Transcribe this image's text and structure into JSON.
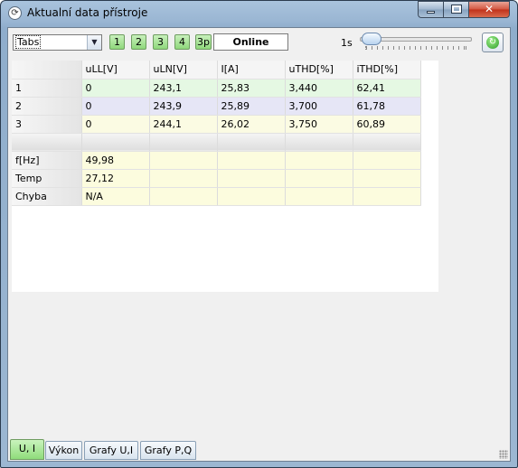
{
  "window": {
    "title": "Aktualní data přístroje",
    "app_icon": "refresh-cycle-icon"
  },
  "toolbar": {
    "mode_select": {
      "value": "Tabs"
    },
    "phase_buttons": [
      "1",
      "2",
      "3",
      "4",
      "3p"
    ],
    "status": "Online",
    "interval_label": "1s",
    "refresh_icon": "refresh-icon"
  },
  "table": {
    "columns": [
      "uLL[V]",
      "uLN[V]",
      "I[A]",
      "uTHD[%]",
      "iTHD[%]"
    ],
    "phase_rows": [
      {
        "label": "1",
        "values": [
          "0",
          "243,1",
          "25,83",
          "3,440",
          "62,41"
        ]
      },
      {
        "label": "2",
        "values": [
          "0",
          "243,9",
          "25,89",
          "3,700",
          "61,78"
        ]
      },
      {
        "label": "3",
        "values": [
          "0",
          "244,1",
          "26,02",
          "3,750",
          "60,89"
        ]
      }
    ],
    "extra_rows": [
      {
        "label": "f[Hz]",
        "value": "49,98"
      },
      {
        "label": "Temp",
        "value": "27,12"
      },
      {
        "label": "Chyba",
        "value": "N/A"
      }
    ]
  },
  "tabs": [
    {
      "label": "U, I",
      "active": true
    },
    {
      "label": "Výkon",
      "active": false
    },
    {
      "label": "Grafy U,I",
      "active": false
    },
    {
      "label": "Grafy P,Q",
      "active": false
    }
  ],
  "colors": {
    "phase1": "#e5f8e3",
    "phase2": "#e6e6f6",
    "phase3": "#fbfbe3",
    "accent_green": "#8fd87c"
  }
}
